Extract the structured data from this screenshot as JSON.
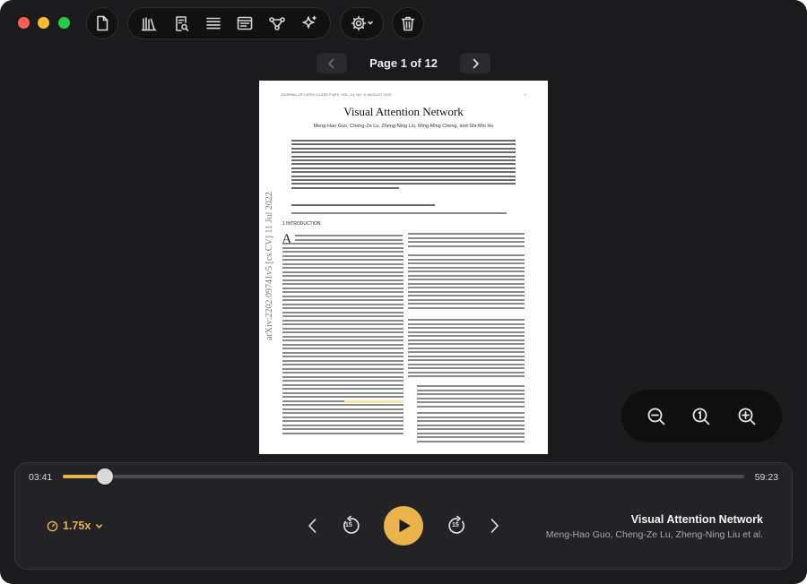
{
  "toolbar": {
    "groups": [
      {
        "icons": [
          "document-icon"
        ]
      },
      {
        "icons": [
          "library-icon",
          "document-search-icon",
          "list-icon",
          "reader-icon",
          "graph-icon",
          "sparkle-icon"
        ]
      },
      {
        "icons": [
          "voice-settings-icon"
        ]
      },
      {
        "icons": [
          "trash-icon"
        ]
      }
    ]
  },
  "pager": {
    "label": "Page 1 of 12",
    "current_page": 1,
    "total_pages": 12
  },
  "document": {
    "header": "JOURNAL OF LATEX CLASS FILES, VOL. 14, NO. 8, AUGUST 2015",
    "page_number": "1",
    "title": "Visual Attention Network",
    "authors": "Meng-Hao Guo, Cheng-Ze Lu, Zheng-Ning Liu, Ming-Ming Cheng, and Shi-Min Hu",
    "arxiv_stamp": "arXiv:2202.09741v5  [cs.CV]  11 Jul 2022",
    "section_heading": "1   INTRODUCTION",
    "dropcap": "A"
  },
  "zoom": {
    "icons": [
      "zoom-out-icon",
      "zoom-reset-icon",
      "zoom-in-icon"
    ]
  },
  "player": {
    "current_time": "03:41",
    "total_time": "59:23",
    "progress": 0.062,
    "speed": "1.75x",
    "skip_back_seconds": "15",
    "skip_forward_seconds": "15",
    "now_playing_title": "Visual Attention Network",
    "now_playing_authors": "Meng-Hao Guo, Cheng-Ze Lu, Zheng-Ning Liu et al.",
    "accent_color": "#e9b44c"
  }
}
